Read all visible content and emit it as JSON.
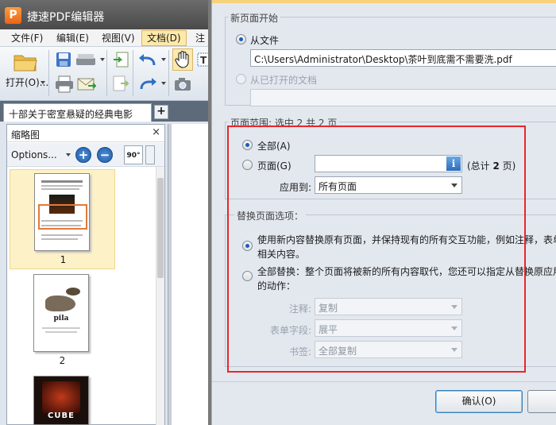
{
  "app": {
    "logo_letter": "P",
    "title": "捷速PDF编辑器"
  },
  "menu": [
    {
      "label": "文件(F)",
      "active": false
    },
    {
      "label": "编辑(E)",
      "active": false
    },
    {
      "label": "视图(V)",
      "active": false
    },
    {
      "label": "文档(D)",
      "active": true
    },
    {
      "label": "注释",
      "active": false
    }
  ],
  "toolbar": {
    "open_label": "打开(O)...",
    "icons": [
      "folder-open-icon",
      "save-icon",
      "scanner-icon",
      "print-icon",
      "email-icon",
      "insert-page-icon",
      "extract-page-icon",
      "undo-icon",
      "redo-icon",
      "hand-tool-icon",
      "text-select-icon",
      "snapshot-icon"
    ]
  },
  "document_tab": {
    "title": "十部关于密室悬疑的经典电影",
    "new_tab_symbol": "+"
  },
  "thumbnail_panel": {
    "title": "缩略图",
    "close_symbol": "×",
    "options_label": "Options...",
    "zoom_in_symbol": "+",
    "zoom_out_symbol": "−",
    "rotate_label": "90°",
    "pages": [
      {
        "number": "1",
        "selected": true
      },
      {
        "number": "2",
        "selected": false
      },
      {
        "number": "",
        "selected": false
      }
    ],
    "page2_caption": "pila",
    "page3_caption": "CUBE"
  },
  "dialog": {
    "new_page_start_legend": "新页面开始",
    "from_file_label": "从文件",
    "file_path": "C:\\Users\\Administrator\\Desktop\\茶叶到底需不需要洗.pdf",
    "from_opened_label": "从已打开的文档",
    "page_range_legend": "页面范围: 选中 2 共 2 页",
    "all_label": "全部(A)",
    "pages_label": "页面(G)",
    "total_prefix": "(总计 ",
    "total_count": "2",
    "total_suffix": " 页)",
    "apply_to_label": "应用到:",
    "apply_to_value": "所有页面",
    "replace_options_legend": "替换页面选项：",
    "option1_line1": "使用新内容替换原有页面，并保持现有的所有交互功能，例如注释，表单",
    "option1_line2": "相关内容。",
    "option2_line1": "全部替换：整个页面将被新的所有内容取代，您还可以指定从替换原应用受",
    "option2_line2": "的动作：",
    "annotation_label": "注释:",
    "annotation_value": "复制",
    "form_fields_label": "表单字段:",
    "form_fields_value": "展平",
    "bookmarks_label": "书签:",
    "bookmarks_value": "全部复制",
    "ok_label": "确认(O)",
    "cancel_label": ""
  },
  "colors": {
    "highlight_frame": "#e8262b",
    "accent_blue": "#1e5fb4",
    "selected_thumb": "#fdf1c7"
  }
}
